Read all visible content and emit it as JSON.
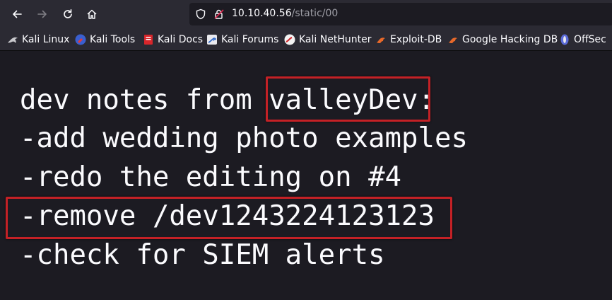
{
  "browser": {
    "url_host": "10.10.40.56",
    "url_path": "/static/00"
  },
  "bookmarks": [
    {
      "label": "Kali Linux",
      "icon": "kali-dragon-icon"
    },
    {
      "label": "Kali Tools",
      "icon": "kali-tools-icon"
    },
    {
      "label": "Kali Docs",
      "icon": "kali-docs-icon"
    },
    {
      "label": "Kali Forums",
      "icon": "kali-forums-icon"
    },
    {
      "label": "Kali NetHunter",
      "icon": "nethunter-icon"
    },
    {
      "label": "Exploit-DB",
      "icon": "exploit-db-icon"
    },
    {
      "label": "Google Hacking DB",
      "icon": "ghdb-icon"
    },
    {
      "label": "OffSec",
      "icon": "offsec-icon"
    }
  ],
  "page": {
    "lines": [
      {
        "text": "dev notes from ",
        "highlight": "valleyDev",
        "suffix": ":"
      },
      {
        "text": "-add wedding photo examples"
      },
      {
        "text": "-redo the editing on #4"
      },
      {
        "text": "-remove /dev1243224123123"
      },
      {
        "text": "-check for SIEM alerts"
      }
    ]
  },
  "colors": {
    "toolbar_bg": "#2b2a33",
    "page_bg": "#1c1b22",
    "text": "#fbfbfe",
    "highlight_border": "#c42126"
  }
}
